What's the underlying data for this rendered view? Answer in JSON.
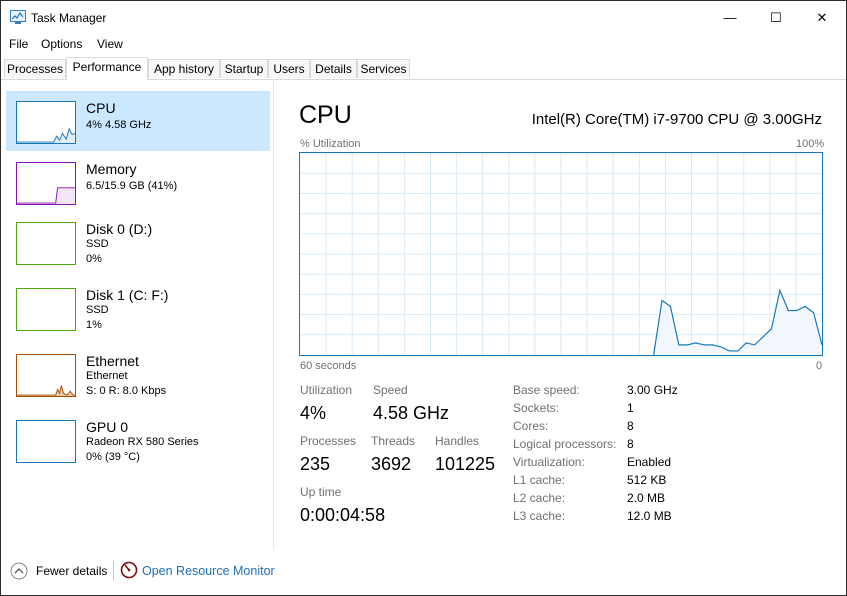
{
  "window": {
    "title": "Task Manager",
    "min_glyph": "—",
    "max_glyph": "☐",
    "close_glyph": "✕"
  },
  "menu": [
    "File",
    "Options",
    "View"
  ],
  "tabs": [
    "Processes",
    "Performance",
    "App history",
    "Startup",
    "Users",
    "Details",
    "Services"
  ],
  "sidebar": [
    {
      "name": "CPU",
      "line1": "4% 4.58 GHz",
      "line2": "",
      "line3": "",
      "color": "#1779ba"
    },
    {
      "name": "Memory",
      "line1": "6.5/15.9 GB (41%)",
      "line2": "",
      "line3": "",
      "color": "#8b12ae"
    },
    {
      "name": "Disk 0 (D:)",
      "line1": "SSD",
      "line2": "0%",
      "line3": "",
      "color": "#4da60c"
    },
    {
      "name": "Disk 1 (C: F:)",
      "line1": "SSD",
      "line2": "1%",
      "line3": "",
      "color": "#4da60c"
    },
    {
      "name": "Ethernet",
      "line1": "Ethernet",
      "line2": "S: 0 R: 8.0 Kbps",
      "line3": "",
      "color": "#a74f01"
    },
    {
      "name": "GPU 0",
      "line1": "Radeon RX 580 Series",
      "line2": "0% (39 °C)",
      "line3": "",
      "color": "#1779ba"
    }
  ],
  "main": {
    "title": "CPU",
    "model": "Intel(R) Core(TM) i7-9700 CPU @ 3.00GHz",
    "graph_label": "% Utilization",
    "graph_max": "100%",
    "graph_time": "60 seconds",
    "graph_min": "0"
  },
  "chart_data": {
    "type": "area",
    "x_range_seconds": [
      60,
      0
    ],
    "ylim": [
      0,
      100
    ],
    "series": [
      {
        "values": [
          0,
          0,
          0,
          0,
          0,
          0,
          0,
          0,
          0,
          0,
          0,
          0,
          0,
          0,
          0,
          0,
          0,
          0,
          0,
          0,
          0,
          0,
          0,
          0,
          0,
          0,
          0,
          0,
          0,
          0,
          0,
          0,
          0,
          0,
          0,
          0,
          0,
          0,
          0,
          0,
          0,
          0,
          0,
          27,
          24,
          5,
          5,
          6,
          5,
          5,
          4,
          2,
          2,
          6,
          5,
          9,
          13,
          32,
          22,
          22,
          24,
          21,
          5
        ]
      }
    ]
  },
  "stats": {
    "utilization_label": "Utilization",
    "utilization": "4%",
    "speed_label": "Speed",
    "speed": "4.58 GHz",
    "processes_label": "Processes",
    "processes": "235",
    "threads_label": "Threads",
    "threads": "3692",
    "handles_label": "Handles",
    "handles": "101225",
    "uptime_label": "Up time",
    "uptime": "0:00:04:58"
  },
  "specs": [
    {
      "label": "Base speed:",
      "value": "3.00 GHz"
    },
    {
      "label": "Sockets:",
      "value": "1"
    },
    {
      "label": "Cores:",
      "value": "8"
    },
    {
      "label": "Logical processors:",
      "value": "8"
    },
    {
      "label": "Virtualization:",
      "value": "Enabled"
    },
    {
      "label": "L1 cache:",
      "value": "512 KB"
    },
    {
      "label": "L2 cache:",
      "value": "2.0 MB"
    },
    {
      "label": "L3 cache:",
      "value": "12.0 MB"
    }
  ],
  "footer": {
    "fewer_details": "Fewer details",
    "open_resource_monitor": "Open Resource Monitor"
  }
}
